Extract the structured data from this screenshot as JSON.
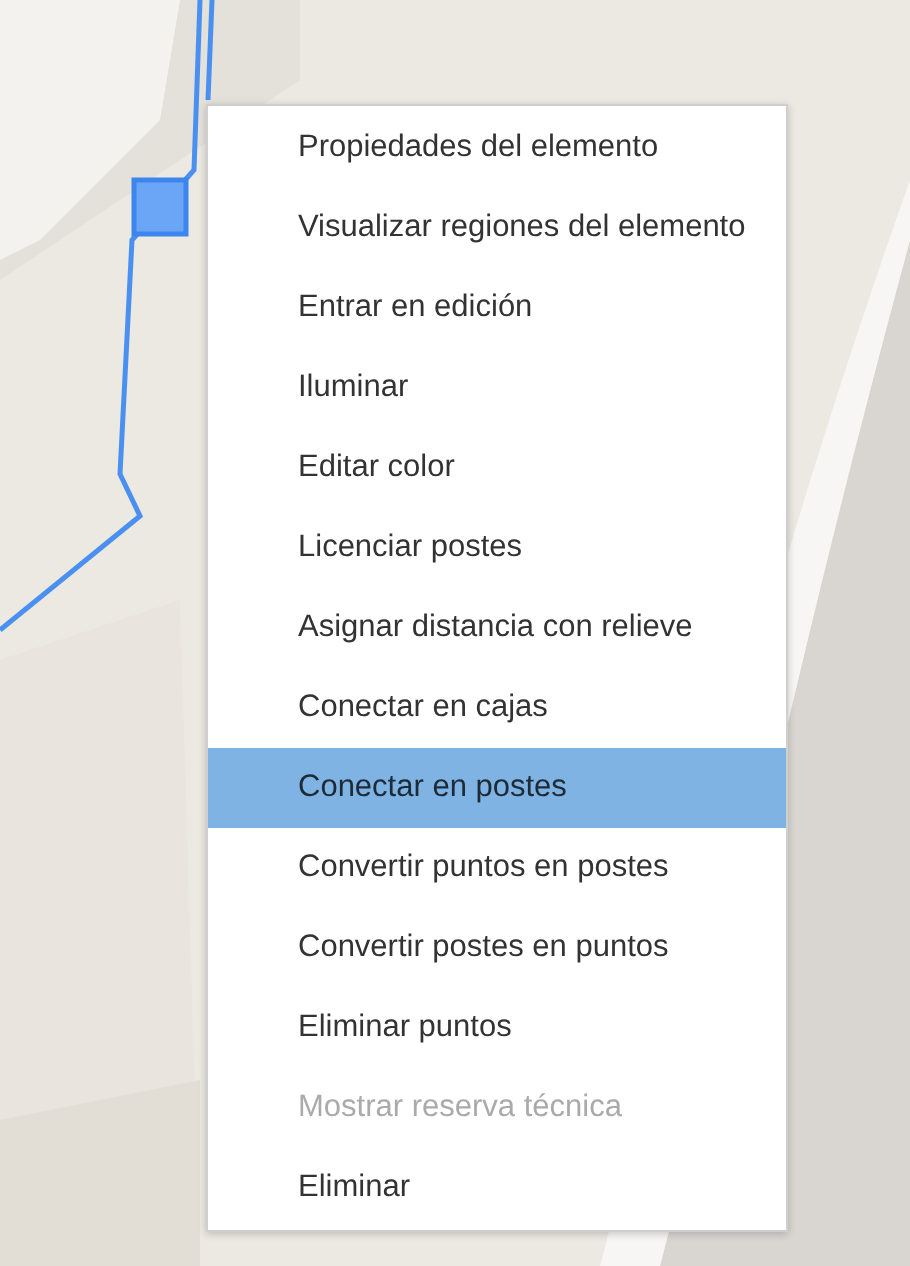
{
  "context_menu": {
    "items": [
      {
        "label": "Propiedades del elemento",
        "selected": false,
        "disabled": false
      },
      {
        "label": "Visualizar regiones del elemento",
        "selected": false,
        "disabled": false
      },
      {
        "label": "Entrar en edición",
        "selected": false,
        "disabled": false
      },
      {
        "label": "Iluminar",
        "selected": false,
        "disabled": false
      },
      {
        "label": "Editar color",
        "selected": false,
        "disabled": false
      },
      {
        "label": "Licenciar postes",
        "selected": false,
        "disabled": false
      },
      {
        "label": "Asignar distancia con relieve",
        "selected": false,
        "disabled": false
      },
      {
        "label": "Conectar en cajas",
        "selected": false,
        "disabled": false
      },
      {
        "label": "Conectar en postes",
        "selected": true,
        "disabled": false
      },
      {
        "label": "Convertir puntos en postes",
        "selected": false,
        "disabled": false
      },
      {
        "label": "Convertir postes en puntos",
        "selected": false,
        "disabled": false
      },
      {
        "label": "Eliminar puntos",
        "selected": false,
        "disabled": false
      },
      {
        "label": "Mostrar reserva técnica",
        "selected": false,
        "disabled": true
      },
      {
        "label": "Eliminar",
        "selected": false,
        "disabled": false
      }
    ]
  }
}
